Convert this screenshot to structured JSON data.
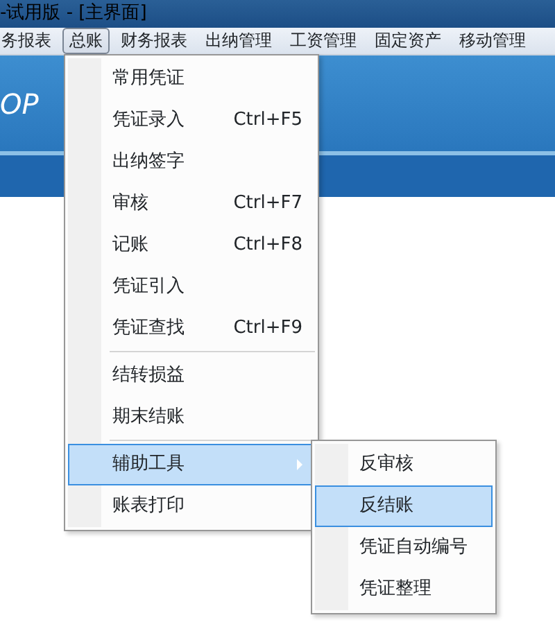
{
  "window": {
    "title": "-试用版 - [主界面]"
  },
  "menubar": [
    {
      "label": "务报表",
      "selected": false
    },
    {
      "label": "总账",
      "selected": true
    },
    {
      "label": "财务报表",
      "selected": false
    },
    {
      "label": "出纳管理",
      "selected": false
    },
    {
      "label": "工资管理",
      "selected": false
    },
    {
      "label": "固定资产",
      "selected": false
    },
    {
      "label": "移动管理",
      "selected": false
    }
  ],
  "banner": {
    "text": "OP"
  },
  "menu": [
    {
      "kind": "item",
      "label": "常用凭证",
      "selected": false
    },
    {
      "kind": "item",
      "label": "凭证录入",
      "shortcut": "Ctrl+F5",
      "selected": false
    },
    {
      "kind": "item",
      "label": "出纳签字",
      "selected": false
    },
    {
      "kind": "item",
      "label": "审核",
      "shortcut": "Ctrl+F7",
      "selected": false
    },
    {
      "kind": "item",
      "label": "记账",
      "shortcut": "Ctrl+F8",
      "selected": false
    },
    {
      "kind": "item",
      "label": "凭证引入",
      "selected": false
    },
    {
      "kind": "item",
      "label": "凭证查找",
      "shortcut": "Ctrl+F9",
      "selected": false
    },
    {
      "kind": "separator"
    },
    {
      "kind": "item",
      "label": "结转损益",
      "selected": false
    },
    {
      "kind": "item",
      "label": "期末结账",
      "selected": false
    },
    {
      "kind": "separator"
    },
    {
      "kind": "submenu",
      "label": "辅助工具",
      "selected": true
    },
    {
      "kind": "item",
      "label": "账表打印",
      "selected": false
    }
  ],
  "submenu": [
    {
      "label": "反审核",
      "selected": false
    },
    {
      "label": "反结账",
      "selected": true
    },
    {
      "label": "凭证自动编号",
      "selected": false
    },
    {
      "label": "凭证整理",
      "selected": false
    }
  ]
}
